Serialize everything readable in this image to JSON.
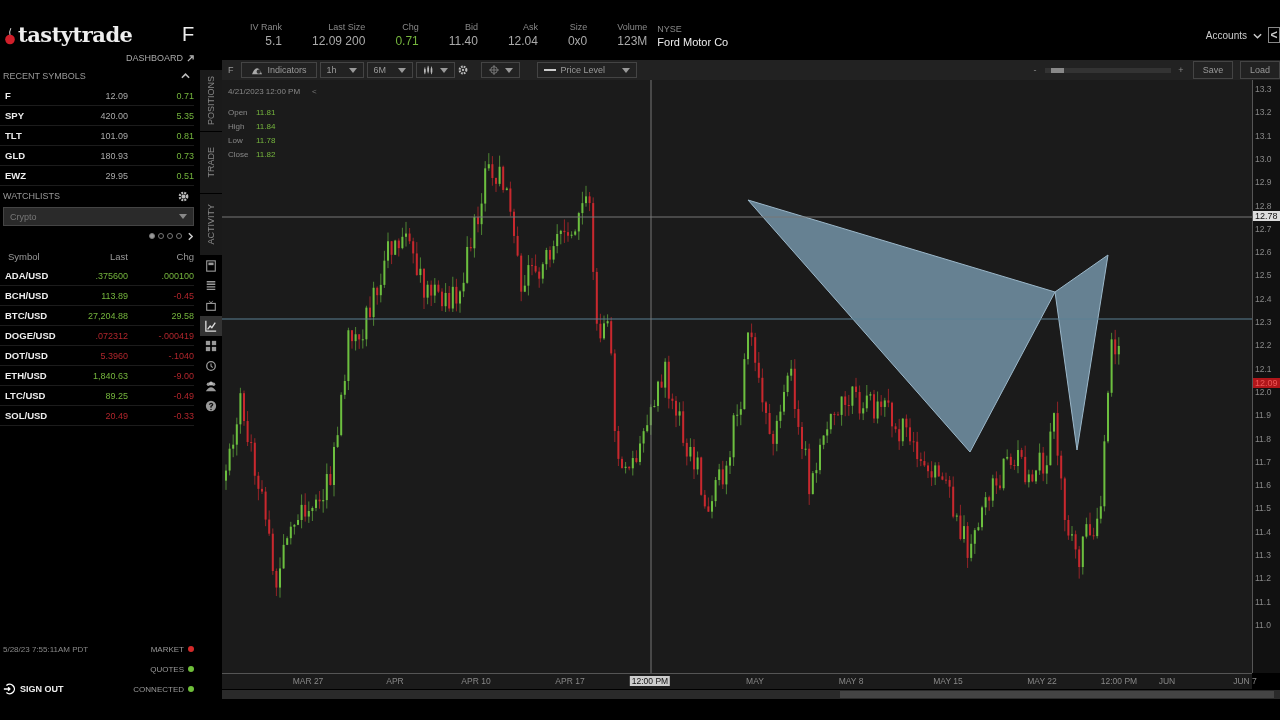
{
  "logo": {
    "text": "tastytrade"
  },
  "quote": {
    "symbol": "F",
    "stats": [
      {
        "label": "IV Rank",
        "value": "5.1",
        "kind": "number"
      },
      {
        "label": "Last Size",
        "value": "12.09 200",
        "kind": "number"
      },
      {
        "label": "Chg",
        "value": "0.71",
        "up": true,
        "kind": "change"
      },
      {
        "label": "Bid",
        "value": "11.40",
        "kind": "number"
      },
      {
        "label": "Ask",
        "value": "12.04",
        "kind": "number"
      },
      {
        "label": "Size",
        "value": "0x0",
        "kind": "number"
      },
      {
        "label": "Volume",
        "value": "123M",
        "kind": "number"
      },
      {
        "label": "NYSE",
        "value": "Ford Motor Co",
        "kind": "name"
      }
    ]
  },
  "accounts": {
    "label": "Accounts",
    "collapse": "<"
  },
  "sidebar": {
    "dashboard": "DASHBOARD",
    "recent_title": "RECENT SYMBOLS",
    "recent_expanded": true,
    "recent": [
      {
        "symbol": "F",
        "last": "12.09",
        "chg": "0.71",
        "chg_up": true
      },
      {
        "symbol": "SPY",
        "last": "420.00",
        "chg": "5.35",
        "chg_up": true
      },
      {
        "symbol": "TLT",
        "last": "101.09",
        "chg": "0.81",
        "chg_up": true
      },
      {
        "symbol": "GLD",
        "last": "180.93",
        "chg": "0.73",
        "chg_up": true
      },
      {
        "symbol": "EWZ",
        "last": "29.95",
        "chg": "0.51",
        "chg_up": true
      }
    ],
    "watchlists_title": "WATCHLISTS",
    "watchlist": {
      "value": "Crypto"
    },
    "pages": [
      {
        "selected": true
      },
      {
        "selected": false
      },
      {
        "selected": false
      },
      {
        "selected": false
      }
    ],
    "columns": [
      "Symbol",
      "Last",
      "Chg"
    ],
    "rows": [
      {
        "symbol": "ADA/USD",
        "last": ".375600",
        "chg": ".000100",
        "last_up": true,
        "chg_up": true
      },
      {
        "symbol": "BCH/USD",
        "last": "113.89",
        "chg": "-0.45",
        "last_up": true,
        "chg_up": false
      },
      {
        "symbol": "BTC/USD",
        "last": "27,204.88",
        "chg": "29.58",
        "last_up": true,
        "chg_up": true
      },
      {
        "symbol": "DOGE/USD",
        "last": ".072312",
        "chg": "-.000419",
        "last_up": false,
        "chg_up": false
      },
      {
        "symbol": "DOT/USD",
        "last": "5.3960",
        "chg": "-.1040",
        "last_up": false,
        "chg_up": false
      },
      {
        "symbol": "ETH/USD",
        "last": "1,840.63",
        "chg": "-9.00",
        "last_up": true,
        "chg_up": false
      },
      {
        "symbol": "LTC/USD",
        "last": "89.25",
        "chg": "-0.49",
        "last_up": true,
        "chg_up": false
      },
      {
        "symbol": "SOL/USD",
        "last": "20.49",
        "chg": "-0.33",
        "last_up": false,
        "chg_up": false
      }
    ],
    "timestamp": "5/28/23 7:55:11AM PDT",
    "sign_out": "SIGN OUT",
    "statuses": [
      {
        "label": "MARKET",
        "color": "#d42a2a"
      },
      {
        "label": "QUOTES",
        "color": "#6fbf3a"
      },
      {
        "label": "CONNECTED",
        "color": "#6fbf3a"
      }
    ]
  },
  "side_tabs": [
    {
      "label": "POSITIONS",
      "selected": false
    },
    {
      "label": "TRADE",
      "selected": false
    },
    {
      "label": "ACTIVITY",
      "selected": false
    }
  ],
  "side_tools": [
    {
      "kind": "calculator",
      "selected": false
    },
    {
      "kind": "list",
      "selected": false
    },
    {
      "kind": "tv",
      "selected": false
    },
    {
      "kind": "chart",
      "selected": true
    },
    {
      "kind": "grid",
      "selected": false
    },
    {
      "kind": "history",
      "selected": false
    },
    {
      "kind": "people",
      "selected": false
    },
    {
      "kind": "help",
      "selected": false
    }
  ],
  "toolbar": {
    "symbol": "F",
    "indicators": "Indicators",
    "interval": "1h",
    "range": "6M",
    "drawing": "Price Level",
    "zoom_minus": "-",
    "zoom_plus": "+",
    "zoom": {
      "level": 0.05
    },
    "save": "Save",
    "load": "Load"
  },
  "chart": {
    "date": "4/21/2023 12:00 PM",
    "collapse": "<",
    "ohlc": [
      {
        "label": "Open",
        "value": "11.81"
      },
      {
        "label": "High",
        "value": "11.84"
      },
      {
        "label": "Low",
        "value": "11.78"
      },
      {
        "label": "Close",
        "value": "11.82"
      }
    ],
    "y_labels": [
      "13.3",
      "13.2",
      "13.1",
      "13.0",
      "12.9",
      "12.8",
      "12.7",
      "12.6",
      "12.5",
      "12.4",
      "12.3",
      "12.2",
      "12.1",
      "12.0",
      "11.9",
      "11.8",
      "11.7",
      "11.6",
      "11.5",
      "11.4",
      "11.3",
      "11.2",
      "11.1",
      "11.0"
    ],
    "crosshair_price": "12.78",
    "last_price": "12.09",
    "x_labels": [
      {
        "text": "MAR 27",
        "kind": "tick"
      },
      {
        "text": "APR",
        "kind": "tick"
      },
      {
        "text": "APR 10",
        "kind": "tick"
      },
      {
        "text": "APR 17",
        "kind": "tick"
      },
      {
        "text": "12:00 PM",
        "kind": "crosshair"
      },
      {
        "text": "MAY",
        "kind": "tick"
      },
      {
        "text": "MAY 8",
        "kind": "tick"
      },
      {
        "text": "MAY 15",
        "kind": "tick"
      },
      {
        "text": "MAY 22",
        "kind": "tick"
      },
      {
        "text": "12:00 PM",
        "kind": "tick"
      },
      {
        "text": "JUN",
        "kind": "tick"
      },
      {
        "text": "JUN 7",
        "kind": "tick"
      }
    ]
  }
}
